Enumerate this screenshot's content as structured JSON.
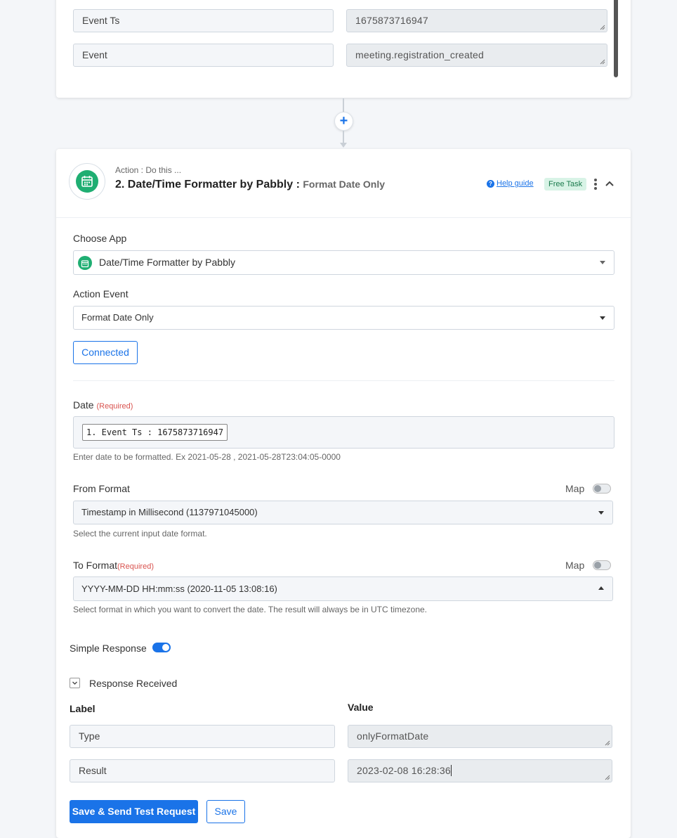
{
  "top_card": {
    "rows": [
      {
        "label": "Event Ts",
        "value": "1675873716947"
      },
      {
        "label": "Event",
        "value": "meeting.registration_created"
      }
    ]
  },
  "action": {
    "subtitle": "Action : Do this ...",
    "title": "2. Date/Time Formatter by Pabbly :",
    "event_name": "Format Date Only",
    "help_link": "Help guide",
    "badge": "Free Task"
  },
  "form": {
    "choose_app_label": "Choose App",
    "choose_app_value": "Date/Time Formatter by Pabbly",
    "action_event_label": "Action Event",
    "action_event_value": "Format Date Only",
    "connected_label": "Connected",
    "date_label": "Date",
    "required_text": "(Required)",
    "date_chip": "1. Event Ts : 1675873716947",
    "date_help": "Enter date to be formatted. Ex 2021-05-28 , 2021-05-28T23:04:05-0000",
    "from_format_label": "From Format",
    "map_label": "Map",
    "from_format_value": "Timestamp in Millisecond (1137971045000)",
    "from_format_help": "Select the current input date format.",
    "to_format_label": "To Format",
    "to_format_value": "YYYY-MM-DD HH:mm:ss (2020-11-05 13:08:16)",
    "to_format_help": "Select format in which you want to convert the date. The result will always be in UTC timezone.",
    "simple_response_label": "Simple Response",
    "response_received_label": "Response Received"
  },
  "response": {
    "label_header": "Label",
    "value_header": "Value",
    "rows": [
      {
        "label": "Type",
        "value": "onlyFormatDate"
      },
      {
        "label": "Result",
        "value": "2023-02-08 16:28:36"
      }
    ]
  },
  "buttons": {
    "save_send": "Save & Send Test Request",
    "save": "Save"
  },
  "colors": {
    "accent": "#1a73e8",
    "app_green": "#1fae72",
    "required_red": "#d9534f"
  },
  "icons": {
    "plus": "plus-icon",
    "calendar": "calendar-icon",
    "help": "question-circle-icon",
    "kebab": "kebab-icon",
    "collapse": "chevron-up-icon",
    "dropdown": "caret-down-icon",
    "checkbox": "checkbox-checked-icon"
  }
}
